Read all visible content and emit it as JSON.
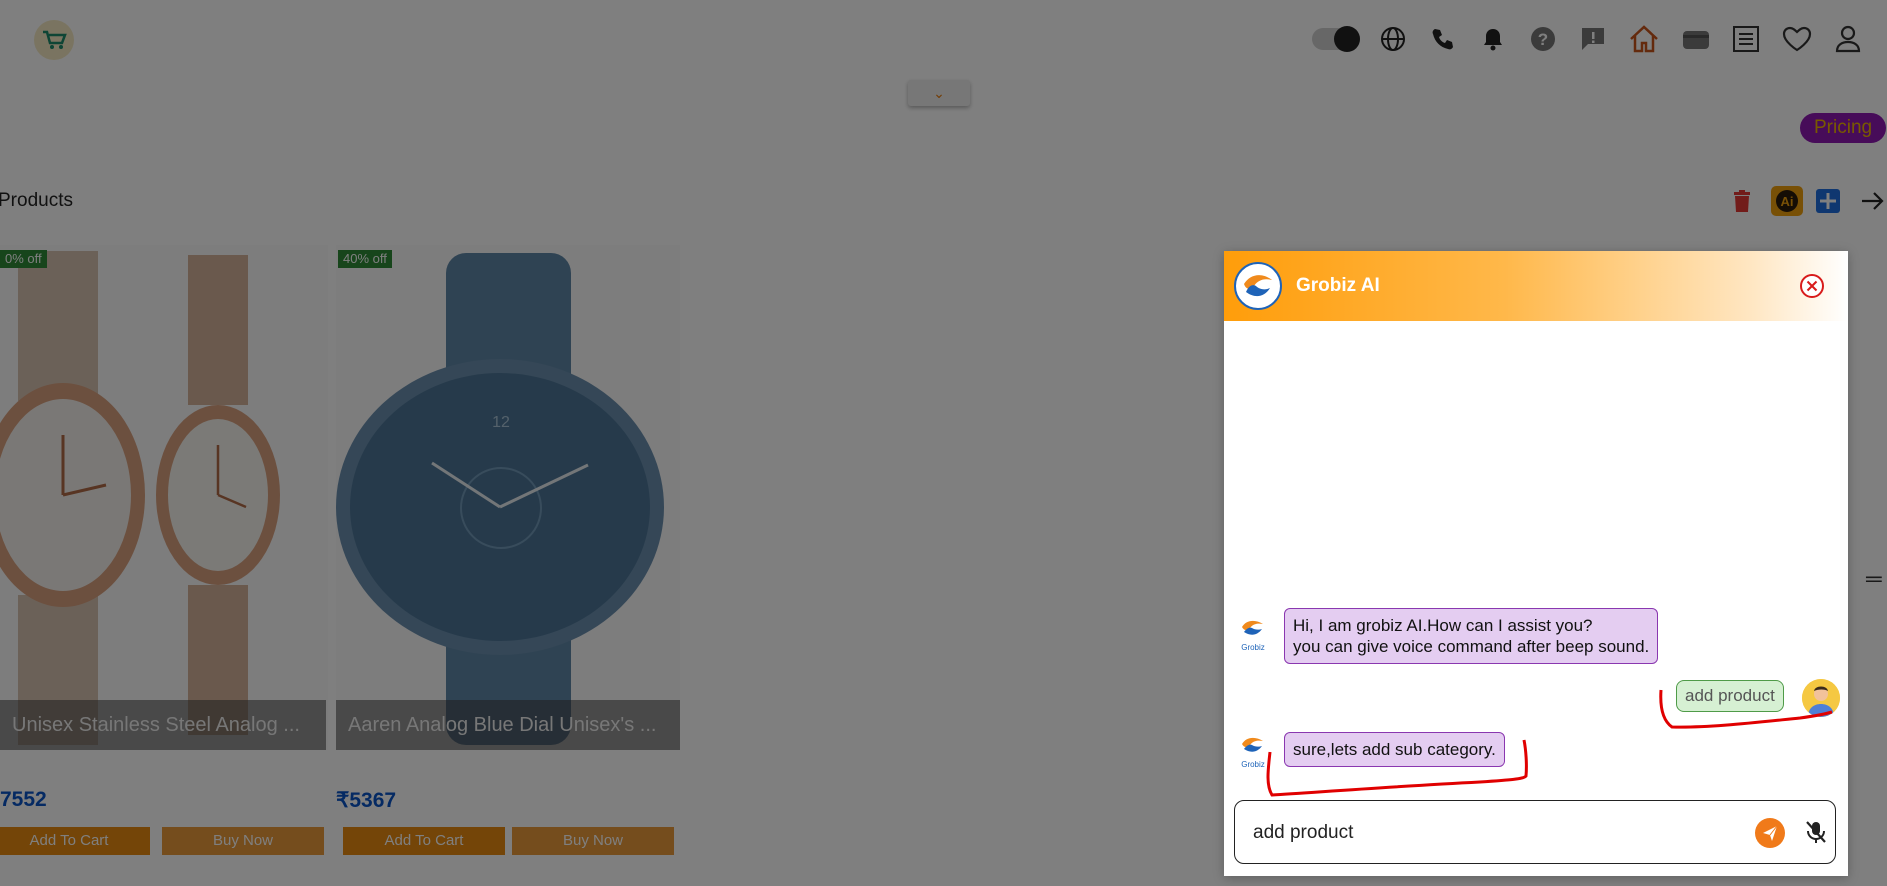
{
  "header": {
    "icons": [
      "theme-toggle",
      "globe-icon",
      "phone-icon",
      "bell-icon",
      "help-icon",
      "feedback-icon",
      "home-icon",
      "wallet-icon",
      "orders-icon",
      "heart-icon",
      "user-icon"
    ],
    "pricing_label": "Pricing"
  },
  "section": {
    "title": "Products"
  },
  "products": [
    {
      "badge": "0% off",
      "name": "Unisex Stainless Steel Analog ...",
      "price": "7552",
      "add_to_cart": "Add To Cart",
      "buy_now": "Buy Now"
    },
    {
      "badge": "40% off",
      "name": "Aaren Analog Blue Dial Unisex's ...",
      "price": "₹5367",
      "add_to_cart": "Add To Cart",
      "buy_now": "Buy Now"
    }
  ],
  "chat": {
    "title": "Grobiz AI",
    "messages": [
      {
        "from": "bot",
        "line1": "Hi, I am grobiz AI.How can I assist you?",
        "line2": "you can give voice command after beep sound."
      },
      {
        "from": "user",
        "text": "add product"
      },
      {
        "from": "bot",
        "text": "sure,lets add sub category."
      }
    ],
    "input_value": "add product",
    "mini_logo_label": "Grobiz"
  },
  "colors": {
    "accent": "#ff9d0a",
    "bot_bubble": "#e4cdf1",
    "user_bubble": "#d6f0d3",
    "pricing": "#8e19b2",
    "annotation": "#e00000"
  }
}
